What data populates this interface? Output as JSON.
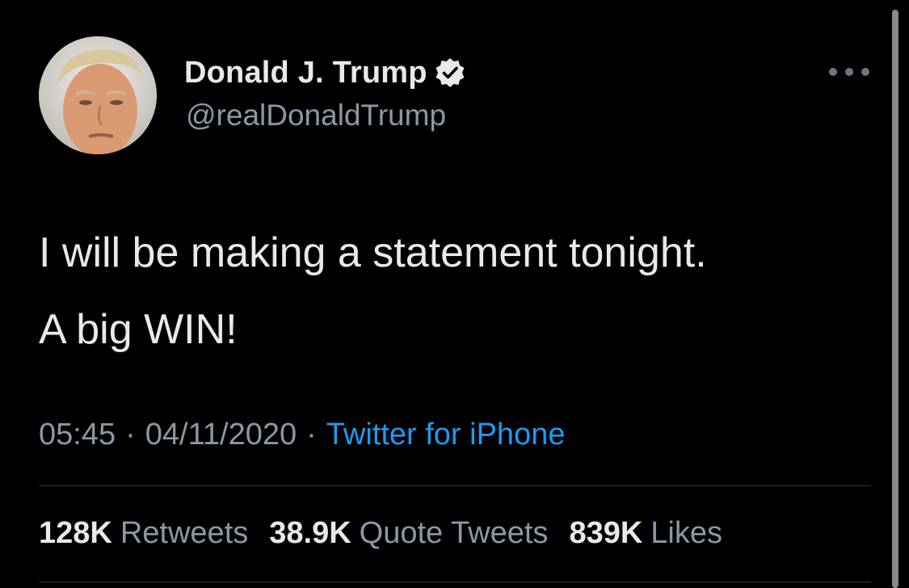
{
  "tweet": {
    "author": {
      "display_name": "Donald J. Trump",
      "handle": "@realDonaldTrump",
      "verified_icon": "verified-badge-icon",
      "avatar": "profile-photo"
    },
    "menu_icon": "more-options-icon",
    "text_lines": [
      "I will be making a statement tonight.",
      "A big WIN!"
    ],
    "time": "05:45",
    "date": "04/11/2020",
    "separator": "·",
    "source": "Twitter for iPhone",
    "stats": [
      {
        "count": "128K",
        "label": "Retweets"
      },
      {
        "count": "38.9K",
        "label": "Quote Tweets"
      },
      {
        "count": "839K",
        "label": "Likes"
      }
    ]
  },
  "colors": {
    "background": "#000000",
    "text_primary": "#e7e9ea",
    "text_secondary": "#8b98a5",
    "link": "#1d9bf0",
    "divider": "#2f3336"
  }
}
